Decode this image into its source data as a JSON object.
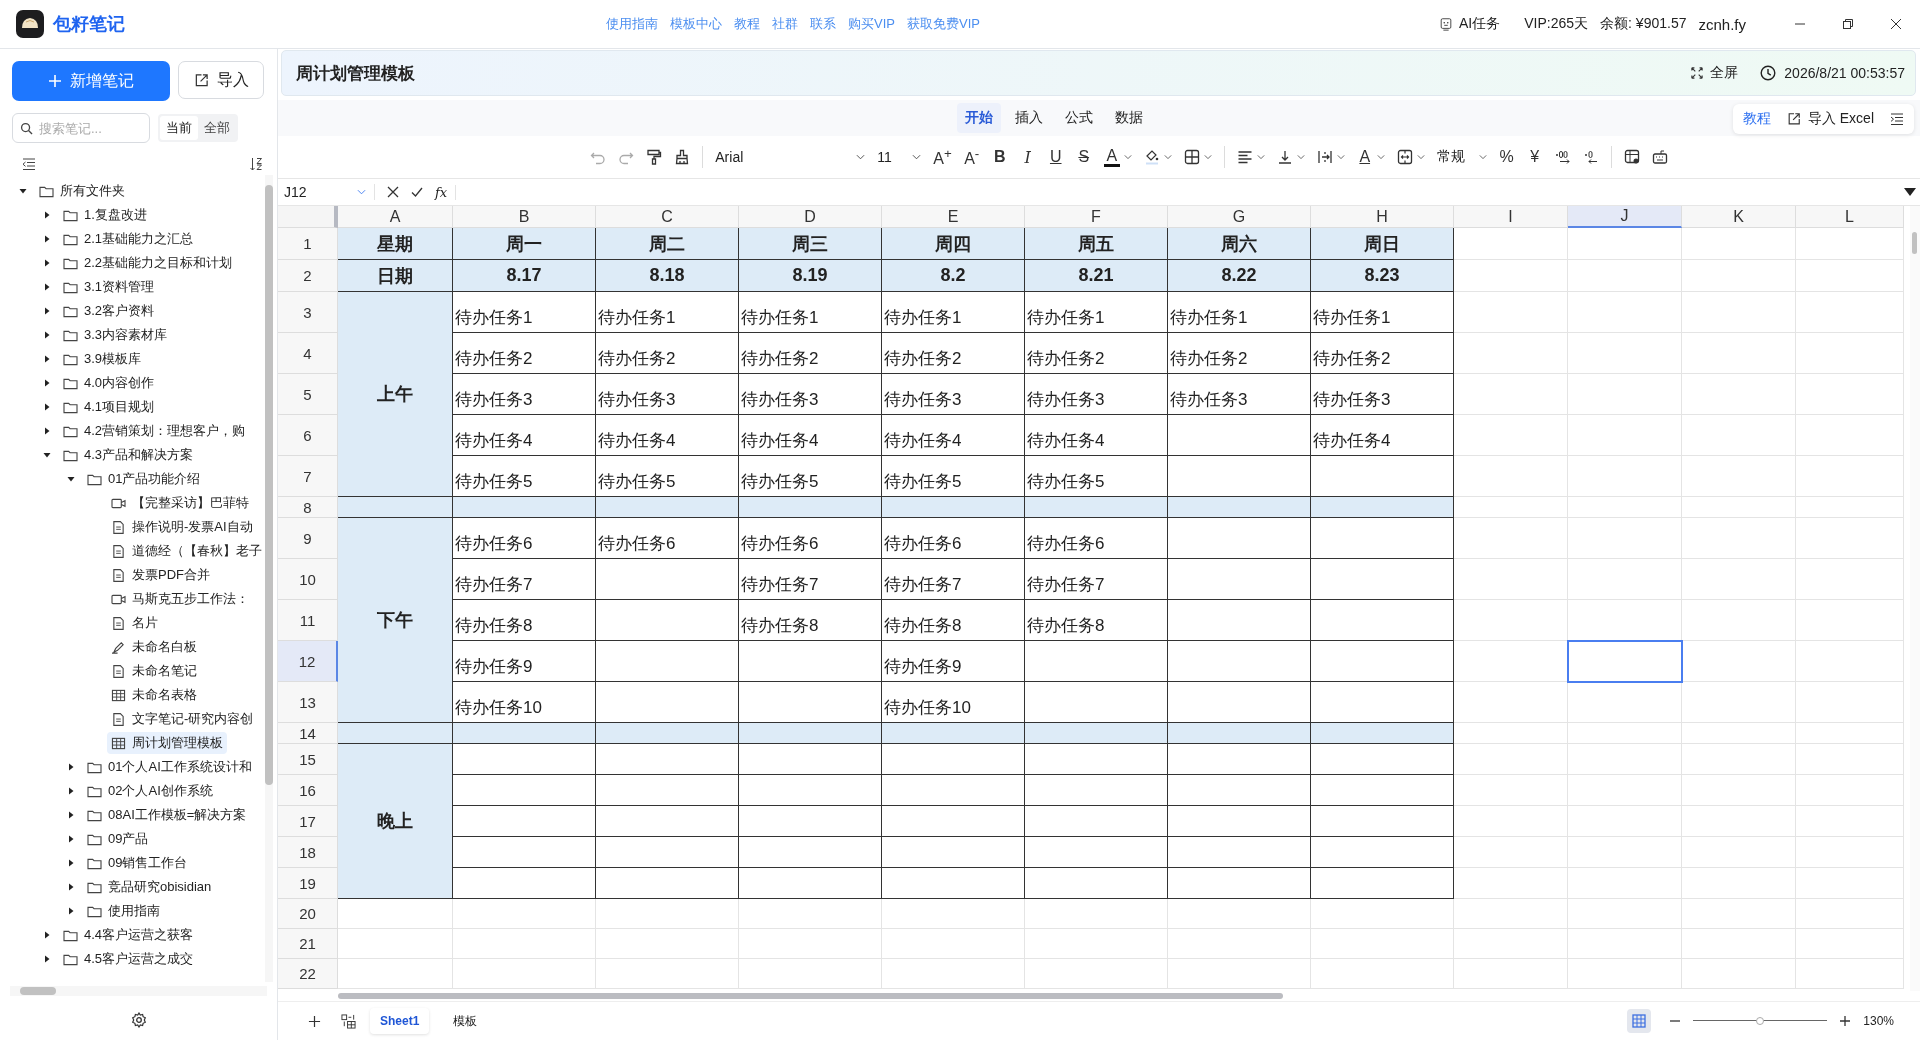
{
  "app": {
    "name": "包籽笔记",
    "links": [
      "使用指南",
      "模板中心",
      "教程",
      "社群",
      "联系",
      "购买VIP",
      "获取免费VIP"
    ],
    "ai_task": "AI任务",
    "vip": "VIP:265天",
    "balance": "余额: ¥901.57",
    "user": "zcnh.fy"
  },
  "sidebar": {
    "new_button": "新增笔记",
    "import_button": "导入",
    "search": {
      "placeholder": "搜索笔记..."
    },
    "scope": [
      {
        "label": "当前",
        "selected": true
      },
      {
        "label": "全部",
        "selected": false
      }
    ],
    "tree": [
      {
        "kind": "folder",
        "label": "所有文件夹",
        "expanded": true,
        "selected": false,
        "children": [
          {
            "kind": "folder",
            "label": "1.复盘改进",
            "expanded": false,
            "selected": false
          },
          {
            "kind": "folder",
            "label": "2.1基础能力之汇总",
            "expanded": false,
            "selected": false
          },
          {
            "kind": "folder",
            "label": "2.2基础能力之目标和计划",
            "expanded": false,
            "selected": false
          },
          {
            "kind": "folder",
            "label": "3.1资料管理",
            "expanded": false,
            "selected": false
          },
          {
            "kind": "folder",
            "label": "3.2客户资料",
            "expanded": false,
            "selected": false
          },
          {
            "kind": "folder",
            "label": "3.3内容素材库",
            "expanded": false,
            "selected": false
          },
          {
            "kind": "folder",
            "label": "3.9模板库",
            "expanded": false,
            "selected": false
          },
          {
            "kind": "folder",
            "label": "4.0内容创作",
            "expanded": false,
            "selected": false
          },
          {
            "kind": "folder",
            "label": "4.1项目规划",
            "expanded": false,
            "selected": false
          },
          {
            "kind": "folder",
            "label": "4.2营销策划：理想客户，购",
            "expanded": false,
            "selected": false
          },
          {
            "kind": "folder",
            "label": "4.3产品和解决方案",
            "expanded": true,
            "selected": false,
            "children": [
              {
                "kind": "folder",
                "label": "01产品功能介绍",
                "expanded": true,
                "selected": false,
                "children": [
                  {
                    "kind": "video",
                    "label": "【完整采访】巴菲特",
                    "selected": false
                  },
                  {
                    "kind": "doc",
                    "label": "操作说明-发票AI自动",
                    "selected": false
                  },
                  {
                    "kind": "doc",
                    "label": "道德经（【春秋】老子",
                    "selected": false
                  },
                  {
                    "kind": "doc",
                    "label": "发票PDF合并",
                    "selected": false
                  },
                  {
                    "kind": "video",
                    "label": "马斯克五步工作法：",
                    "selected": false
                  },
                  {
                    "kind": "doc",
                    "label": "名片",
                    "selected": false
                  },
                  {
                    "kind": "whiteboard",
                    "label": "未命名白板",
                    "selected": false
                  },
                  {
                    "kind": "doc",
                    "label": "未命名笔记",
                    "selected": false
                  },
                  {
                    "kind": "sheet",
                    "label": "未命名表格",
                    "selected": false
                  },
                  {
                    "kind": "doc",
                    "label": "文字笔记-研究内容创",
                    "selected": false
                  },
                  {
                    "kind": "sheet",
                    "label": "周计划管理模板",
                    "selected": true
                  }
                ]
              },
              {
                "kind": "folder",
                "label": "01个人AI工作系统设计和",
                "expanded": false,
                "selected": false
              },
              {
                "kind": "folder",
                "label": "02个人AI创作系统",
                "expanded": false,
                "selected": false
              },
              {
                "kind": "folder",
                "label": "08AI工作模板=解决方案",
                "expanded": false,
                "selected": false
              },
              {
                "kind": "folder",
                "label": "09产品",
                "expanded": false,
                "selected": false
              },
              {
                "kind": "folder",
                "label": "09销售工作台",
                "expanded": false,
                "selected": false
              },
              {
                "kind": "folder",
                "label": "竞品研究obisidian",
                "expanded": false,
                "selected": false
              },
              {
                "kind": "folder",
                "label": "使用指南",
                "expanded": false,
                "selected": false
              }
            ]
          },
          {
            "kind": "folder",
            "label": "4.4客户运营之获客",
            "expanded": false,
            "selected": false
          },
          {
            "kind": "folder",
            "label": "4.5客户运营之成交",
            "expanded": false,
            "selected": false
          }
        ]
      }
    ]
  },
  "document": {
    "title": "周计划管理模板",
    "fullscreen": "全屏",
    "timestamp": "2026/8/21 00:53:57"
  },
  "ribbon": {
    "tabs": [
      {
        "label": "开始",
        "selected": true
      },
      {
        "label": "插入",
        "selected": false
      },
      {
        "label": "公式",
        "selected": false
      },
      {
        "label": "数据",
        "selected": false
      }
    ],
    "tutorial": "教程",
    "import_excel": "导入 Excel"
  },
  "toolbar": {
    "font": "Arial",
    "font_size": "11",
    "grow_font": "A$^{+}$",
    "shrink_font": "A$^{-}$",
    "bold": "B",
    "italic": "I",
    "underline": "U",
    "strikethrough": "S",
    "font_color": "A",
    "text_color_2": "A",
    "number_format": "常规",
    "percent": "%",
    "currency": "¥"
  },
  "formula_bar": {
    "name_box": "J12",
    "function_label": "fx"
  },
  "sheet": {
    "columns": [
      {
        "label": "A",
        "selected": false
      },
      {
        "label": "B",
        "selected": false
      },
      {
        "label": "C",
        "selected": false
      },
      {
        "label": "D",
        "selected": false
      },
      {
        "label": "E",
        "selected": false
      },
      {
        "label": "F",
        "selected": false
      },
      {
        "label": "G",
        "selected": false
      },
      {
        "label": "H",
        "selected": false
      },
      {
        "label": "I",
        "selected": false
      },
      {
        "label": "J",
        "selected": true
      },
      {
        "label": "K",
        "selected": false
      },
      {
        "label": "L",
        "selected": false
      }
    ],
    "rows": [
      {
        "label": "1",
        "selected": false
      },
      {
        "label": "2",
        "selected": false
      },
      {
        "label": "3",
        "selected": false
      },
      {
        "label": "4",
        "selected": false
      },
      {
        "label": "5",
        "selected": false
      },
      {
        "label": "6",
        "selected": false
      },
      {
        "label": "7",
        "selected": false
      },
      {
        "label": "8",
        "selected": false
      },
      {
        "label": "9",
        "selected": false
      },
      {
        "label": "10",
        "selected": false
      },
      {
        "label": "11",
        "selected": false
      },
      {
        "label": "12",
        "selected": true
      },
      {
        "label": "13",
        "selected": false
      },
      {
        "label": "14",
        "selected": false
      },
      {
        "label": "15",
        "selected": false
      },
      {
        "label": "16",
        "selected": false
      },
      {
        "label": "17",
        "selected": false
      },
      {
        "label": "18",
        "selected": false
      },
      {
        "label": "19",
        "selected": false
      },
      {
        "label": "20",
        "selected": false
      },
      {
        "label": "21",
        "selected": false
      },
      {
        "label": "22",
        "selected": false
      }
    ],
    "table": [
      {
        "kind": "header",
        "label": "星期",
        "cells": [
          "周一",
          "周二",
          "周三",
          "周四",
          "周五",
          "周六",
          "周日"
        ]
      },
      {
        "kind": "header",
        "label": "日期",
        "cells": [
          "8.17",
          "8.18",
          "8.19",
          "8.2",
          "8.21",
          "8.22",
          "8.23"
        ]
      },
      {
        "kind": "section",
        "label": "上午",
        "rows": [
          [
            "待办任务1",
            "待办任务1",
            "待办任务1",
            "待办任务1",
            "待办任务1",
            "待办任务1",
            "待办任务1"
          ],
          [
            "待办任务2",
            "待办任务2",
            "待办任务2",
            "待办任务2",
            "待办任务2",
            "待办任务2",
            "待办任务2"
          ],
          [
            "待办任务3",
            "待办任务3",
            "待办任务3",
            "待办任务3",
            "待办任务3",
            "待办任务3",
            "待办任务3"
          ],
          [
            "待办任务4",
            "待办任务4",
            "待办任务4",
            "待办任务4",
            "待办任务4",
            null,
            "待办任务4"
          ],
          [
            "待办任务5",
            "待办任务5",
            "待办任务5",
            "待办任务5",
            "待办任务5",
            null,
            null
          ]
        ]
      },
      {
        "kind": "separator"
      },
      {
        "kind": "section",
        "label": "下午",
        "rows": [
          [
            "待办任务6",
            "待办任务6",
            "待办任务6",
            "待办任务6",
            "待办任务6",
            null,
            null
          ],
          [
            "待办任务7",
            null,
            "待办任务7",
            "待办任务7",
            "待办任务7",
            null,
            null
          ],
          [
            "待办任务8",
            null,
            "待办任务8",
            "待办任务8",
            "待办任务8",
            null,
            null
          ],
          [
            "待办任务9",
            null,
            null,
            "待办任务9",
            null,
            null,
            null
          ],
          [
            "待办任务10",
            null,
            null,
            "待办任务10",
            null,
            null,
            null
          ]
        ]
      },
      {
        "kind": "separator"
      },
      {
        "kind": "section",
        "label": "晚上",
        "rows": [
          [
            null,
            null,
            null,
            null,
            null,
            null,
            null
          ],
          [
            null,
            null,
            null,
            null,
            null,
            null,
            null
          ],
          [
            null,
            null,
            null,
            null,
            null,
            null,
            null
          ],
          [
            null,
            null,
            null,
            null,
            null,
            null,
            null
          ],
          [
            null,
            null,
            null,
            null,
            null,
            null,
            null
          ]
        ]
      }
    ]
  },
  "sheet_bar": {
    "tabs": [
      {
        "label": "Sheet1",
        "selected": true
      },
      {
        "label": "模板",
        "selected": false
      }
    ],
    "zoom": {
      "level": 0.5,
      "reading": "130%"
    }
  }
}
